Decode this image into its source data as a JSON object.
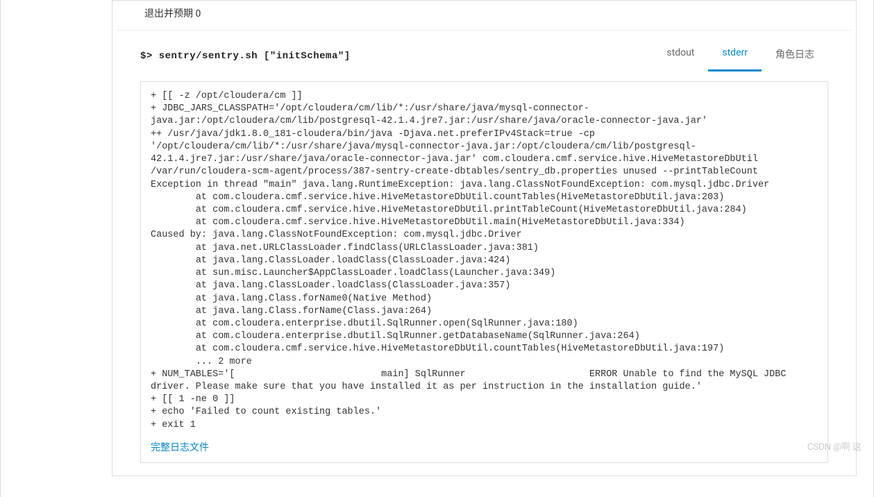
{
  "exit_status": "退出并预期 0",
  "command": "$> sentry/sentry.sh [\"initSchema\"]",
  "tabs": {
    "stdout": "stdout",
    "stderr": "stderr",
    "rolelog": "角色日志"
  },
  "log_text": "+ [[ -z /opt/cloudera/cm ]]\n+ JDBC_JARS_CLASSPATH='/opt/cloudera/cm/lib/*:/usr/share/java/mysql-connector-java.jar:/opt/cloudera/cm/lib/postgresql-42.1.4.jre7.jar:/usr/share/java/oracle-connector-java.jar'\n++ /usr/java/jdk1.8.0_181-cloudera/bin/java -Djava.net.preferIPv4Stack=true -cp '/opt/cloudera/cm/lib/*:/usr/share/java/mysql-connector-java.jar:/opt/cloudera/cm/lib/postgresql-42.1.4.jre7.jar:/usr/share/java/oracle-connector-java.jar' com.cloudera.cmf.service.hive.HiveMetastoreDbUtil /var/run/cloudera-scm-agent/process/387-sentry-create-dbtables/sentry_db.properties unused --printTableCount\nException in thread \"main\" java.lang.RuntimeException: java.lang.ClassNotFoundException: com.mysql.jdbc.Driver\n        at com.cloudera.cmf.service.hive.HiveMetastoreDbUtil.countTables(HiveMetastoreDbUtil.java:203)\n        at com.cloudera.cmf.service.hive.HiveMetastoreDbUtil.printTableCount(HiveMetastoreDbUtil.java:284)\n        at com.cloudera.cmf.service.hive.HiveMetastoreDbUtil.main(HiveMetastoreDbUtil.java:334)\nCaused by: java.lang.ClassNotFoundException: com.mysql.jdbc.Driver\n        at java.net.URLClassLoader.findClass(URLClassLoader.java:381)\n        at java.lang.ClassLoader.loadClass(ClassLoader.java:424)\n        at sun.misc.Launcher$AppClassLoader.loadClass(Launcher.java:349)\n        at java.lang.ClassLoader.loadClass(ClassLoader.java:357)\n        at java.lang.Class.forName0(Native Method)\n        at java.lang.Class.forName(Class.java:264)\n        at com.cloudera.enterprise.dbutil.SqlRunner.open(SqlRunner.java:180)\n        at com.cloudera.enterprise.dbutil.SqlRunner.getDatabaseName(SqlRunner.java:264)\n        at com.cloudera.cmf.service.hive.HiveMetastoreDbUtil.countTables(HiveMetastoreDbUtil.java:197)\n        ... 2 more\n+ NUM_TABLES='[                          main] SqlRunner                      ERROR Unable to find the MySQL JDBC driver. Please make sure that you have installed it as per instruction in the installation guide.'\n+ [[ 1 -ne 0 ]]\n+ echo 'Failed to count existing tables.'\n+ exit 1",
  "full_log_link": "完整日志文件",
  "watermark": "CSDN @啊 这"
}
